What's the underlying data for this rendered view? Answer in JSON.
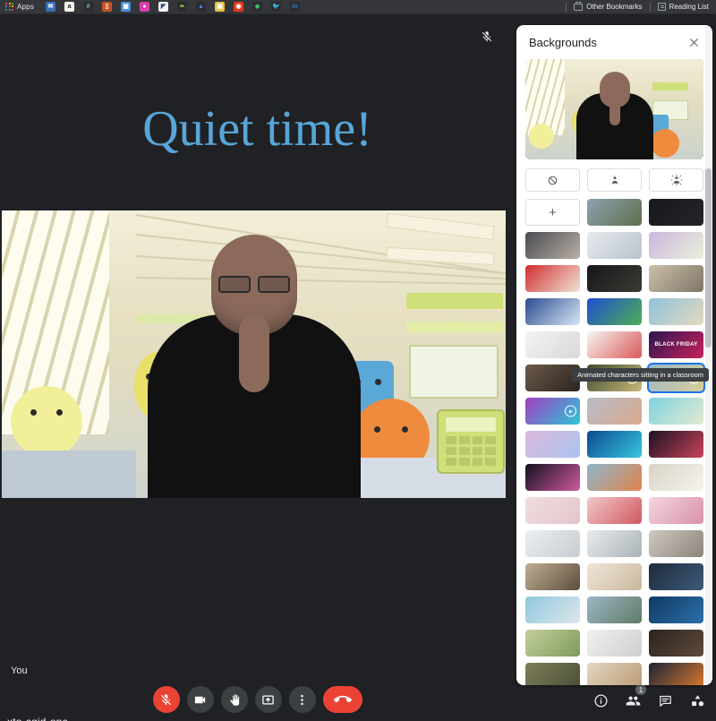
{
  "browser": {
    "apps_label": "Apps",
    "bookmark_icons": [
      {
        "name": "bookmark-icon-email",
        "glyph": "✉",
        "color": "#3b6fb5"
      },
      {
        "name": "bookmark-icon-amazon",
        "glyph": "a",
        "color": "#f5f2e8",
        "fg": "#222"
      },
      {
        "name": "bookmark-icon-slack",
        "glyph": "#",
        "color": "#2b2c30",
        "fg": "#7fb8d4"
      },
      {
        "name": "bookmark-icon-bag",
        "glyph": "▯",
        "color": "#c4542a"
      },
      {
        "name": "bookmark-icon-calendar",
        "glyph": "▦",
        "color": "#4a8fd4"
      },
      {
        "name": "bookmark-icon-dribbble",
        "glyph": "●",
        "color": "#d93fa8"
      },
      {
        "name": "bookmark-icon-whitepage",
        "glyph": "◤",
        "color": "#f2f2f2",
        "fg": "#2a4a7a"
      },
      {
        "name": "bookmark-icon-leaf",
        "glyph": "❧",
        "color": "#2b2c30",
        "fg": "#8bc34a"
      },
      {
        "name": "bookmark-icon-drive",
        "glyph": "▲",
        "color": "#2b2c30",
        "fg": "#4285f4"
      },
      {
        "name": "bookmark-icon-yellow-note",
        "glyph": "▣",
        "color": "#e8c34a"
      },
      {
        "name": "bookmark-icon-reddit",
        "glyph": "◉",
        "color": "#e03a1e"
      },
      {
        "name": "bookmark-icon-green-diamond",
        "glyph": "◆",
        "color": "#2b2c30",
        "fg": "#3ec46d"
      },
      {
        "name": "bookmark-icon-twitter",
        "glyph": "🐦",
        "color": "#2b2c30",
        "fg": "#1da1f2"
      },
      {
        "name": "bookmark-icon-linkedin",
        "glyph": "in",
        "color": "#2b2c30",
        "fg": "#2f7fc1"
      }
    ],
    "other_bookmarks": "Other Bookmarks",
    "reading_list": "Reading List"
  },
  "meeting": {
    "title_overlay": "Quiet time!",
    "title_color": "#58a6d8",
    "self_name": "You",
    "meeting_code": "xto-cqid-onc",
    "muted_indicator": "mic-off-icon"
  },
  "toolbar": {
    "buttons": [
      {
        "name": "microphone-button",
        "label": "Turn off microphone",
        "state": "muted",
        "style": "danger"
      },
      {
        "name": "camera-button",
        "label": "Turn off camera",
        "state": "on",
        "style": "normal"
      },
      {
        "name": "raise-hand-button",
        "label": "Raise hand",
        "state": "off",
        "style": "normal"
      },
      {
        "name": "present-screen-button",
        "label": "Present now",
        "state": "off",
        "style": "normal"
      },
      {
        "name": "more-options-button",
        "label": "More options",
        "state": "off",
        "style": "normal"
      },
      {
        "name": "leave-call-button",
        "label": "Leave call",
        "state": "off",
        "style": "end"
      }
    ],
    "right_actions": [
      {
        "name": "meeting-details-button",
        "label": "Meeting details",
        "badge": ""
      },
      {
        "name": "people-button",
        "label": "Show everyone",
        "badge": "1"
      },
      {
        "name": "chat-button",
        "label": "Chat with everyone",
        "badge": ""
      },
      {
        "name": "activities-button",
        "label": "Activities",
        "badge": ""
      }
    ]
  },
  "backgrounds_panel": {
    "title": "Backgrounds",
    "close_label": "Close",
    "tooltip": "Animated characters sitting in a classroom",
    "effect_buttons": [
      {
        "name": "no-effect-button",
        "label": "Turn off background effects",
        "icon": "no-effect-icon"
      },
      {
        "name": "slight-blur-button",
        "label": "Slightly blur your background",
        "icon": "slight-blur-icon"
      },
      {
        "name": "blur-background-button",
        "label": "Blur your background",
        "icon": "blur-background-icon"
      }
    ],
    "add_button": {
      "name": "add-background-button",
      "label": "+"
    },
    "thumbnails": [
      {
        "id": 1,
        "name": "mountain-landscape",
        "type": "image",
        "c1": "#8ea2b0",
        "c2": "#5e6f4a"
      },
      {
        "id": 2,
        "name": "dark-office-night",
        "type": "image",
        "c1": "#17181c",
        "c2": "#23252b"
      },
      {
        "id": 3,
        "name": "person-decorating-shelf",
        "type": "image",
        "c1": "#4a4a52",
        "c2": "#b8b0a4"
      },
      {
        "id": 4,
        "name": "snow-frost-pattern",
        "type": "image",
        "c1": "#e7eaee",
        "c2": "#b9c3cc"
      },
      {
        "id": 5,
        "name": "purple-foliage",
        "type": "image",
        "c1": "#cdb6e0",
        "c2": "#e8f0d8"
      },
      {
        "id": 6,
        "name": "santa-claus",
        "type": "image",
        "c1": "#d02f2f",
        "c2": "#f0e3d6"
      },
      {
        "id": 7,
        "name": "christmas-house-lights",
        "type": "image",
        "c1": "#16171b",
        "c2": "#3c3a33"
      },
      {
        "id": 8,
        "name": "elf-movie-scene",
        "type": "image",
        "c1": "#cbc0ac",
        "c2": "#7e7565"
      },
      {
        "id": 9,
        "name": "snoopy-winter-cartoon",
        "type": "image",
        "c1": "#2a4c8f",
        "c2": "#d9e6f5"
      },
      {
        "id": 10,
        "name": "grinch-hand-green",
        "type": "image",
        "c1": "#1d4fd0",
        "c2": "#4fae55"
      },
      {
        "id": 11,
        "name": "beach-snowman",
        "type": "image",
        "c1": "#8fc2d8",
        "c2": "#e4d9c0"
      },
      {
        "id": 12,
        "name": "paper-sketch-lines",
        "type": "image",
        "c1": "#f3f3f3",
        "c2": "#d9d9d9"
      },
      {
        "id": 13,
        "name": "doodle-faces-drawing",
        "type": "image",
        "c1": "#f7f5f1",
        "c2": "#d95a5a"
      },
      {
        "id": 14,
        "name": "black-friday-banner",
        "type": "image",
        "c1": "#2a1550",
        "c2": "#c8235c",
        "label": "BLACK FRIDAY"
      },
      {
        "id": 15,
        "name": "crowd-concert",
        "type": "image",
        "c1": "#6b5a4a",
        "c2": "#2c241e"
      },
      {
        "id": 16,
        "name": "abstract-swirl-animated",
        "type": "animated",
        "c1": "#3d4b2f",
        "c2": "#c9b87a"
      },
      {
        "id": 17,
        "name": "animated-classroom",
        "type": "animated",
        "c1": "#9ab7c8",
        "c2": "#d8cf9a",
        "selected": true
      },
      {
        "id": 18,
        "name": "neon-abstract-animated",
        "type": "animated",
        "c1": "#a23cc0",
        "c2": "#2dc8d8"
      },
      {
        "id": 19,
        "name": "sunset-gradient-plain",
        "type": "image",
        "c1": "#b9bcc7",
        "c2": "#d9a98e"
      },
      {
        "id": 20,
        "name": "tropical-beach",
        "type": "image",
        "c1": "#7fd3de",
        "c2": "#e4e9d2"
      },
      {
        "id": 21,
        "name": "pastel-clouds",
        "type": "image",
        "c1": "#dcb8dd",
        "c2": "#a9c4ee"
      },
      {
        "id": 22,
        "name": "blue-energy-abstract",
        "type": "image",
        "c1": "#0d4a8f",
        "c2": "#37c6e0"
      },
      {
        "id": 23,
        "name": "red-nebula-space",
        "type": "image",
        "c1": "#1b1222",
        "c2": "#c8435a"
      },
      {
        "id": 24,
        "name": "fireworks-night",
        "type": "image",
        "c1": "#120f1c",
        "c2": "#d05aa0"
      },
      {
        "id": 25,
        "name": "autumn-tree-blossom",
        "type": "image",
        "c1": "#8fb6cc",
        "c2": "#e0824a"
      },
      {
        "id": 26,
        "name": "white-blossom-branches",
        "type": "image",
        "c1": "#d9d4c6",
        "c2": "#f6f3ee"
      },
      {
        "id": 27,
        "name": "pink-bokeh",
        "type": "image",
        "c1": "#f0dede",
        "c2": "#e3c5cc"
      },
      {
        "id": 28,
        "name": "pink-tiled-pattern",
        "type": "image",
        "c1": "#f2c8cb",
        "c2": "#d0585f"
      },
      {
        "id": 29,
        "name": "cherry-blossom-pink",
        "type": "image",
        "c1": "#f4d7e0",
        "c2": "#d98fa8"
      },
      {
        "id": 30,
        "name": "white-modern-interior",
        "type": "image",
        "c1": "#eceff1",
        "c2": "#c8cdd2"
      },
      {
        "id": 31,
        "name": "bright-living-room",
        "type": "image",
        "c1": "#e8ebec",
        "c2": "#aab3b8"
      },
      {
        "id": 32,
        "name": "grey-lounge-room",
        "type": "image",
        "c1": "#cfc9c1",
        "c2": "#8b837a"
      },
      {
        "id": 33,
        "name": "bookshelf-office",
        "type": "image",
        "c1": "#bfae95",
        "c2": "#5e4d3a"
      },
      {
        "id": 34,
        "name": "window-curtain-room",
        "type": "image",
        "c1": "#efe6d9",
        "c2": "#c9b79c"
      },
      {
        "id": 35,
        "name": "dark-navy-office",
        "type": "image",
        "c1": "#1d2a3c",
        "c2": "#3e5a78"
      },
      {
        "id": 36,
        "name": "ocean-horizon",
        "type": "image",
        "c1": "#8fc7df",
        "c2": "#dfe7ea"
      },
      {
        "id": 37,
        "name": "mountain-lake-scenic",
        "type": "image",
        "c1": "#9db6c6",
        "c2": "#5f7a66"
      },
      {
        "id": 38,
        "name": "deep-blue-ocean",
        "type": "image",
        "c1": "#0f3a63",
        "c2": "#2d6fa8"
      },
      {
        "id": 39,
        "name": "green-field-landscape",
        "type": "image",
        "c1": "#c3cf9c",
        "c2": "#7f9a5c"
      },
      {
        "id": 40,
        "name": "white-room-window",
        "type": "image",
        "c1": "#f0f0ee",
        "c2": "#cfd0cd"
      },
      {
        "id": 41,
        "name": "dark-wood-interior",
        "type": "image",
        "c1": "#2c2420",
        "c2": "#5d4a3a"
      },
      {
        "id": 42,
        "name": "horses-in-field",
        "type": "image",
        "c1": "#7d7f5a",
        "c2": "#4c4e36"
      },
      {
        "id": 43,
        "name": "warm-lamp-corner",
        "type": "image",
        "c1": "#e3d7c4",
        "c2": "#b99a72"
      },
      {
        "id": 44,
        "name": "autumn-leaves-dark",
        "type": "image",
        "c1": "#1b2436",
        "c2": "#dd7b2f"
      },
      {
        "id": 45,
        "name": "navy-palm-pattern",
        "type": "image",
        "c1": "#20305c",
        "c2": "#9fb4d8"
      },
      {
        "id": 46,
        "name": "city-skyline-dusk",
        "type": "image",
        "c1": "#5b4a63",
        "c2": "#9a8aa5"
      },
      {
        "id": 47,
        "name": "green-leaf-pattern",
        "type": "image",
        "c1": "#e6f2de",
        "c2": "#6cb356"
      }
    ]
  }
}
